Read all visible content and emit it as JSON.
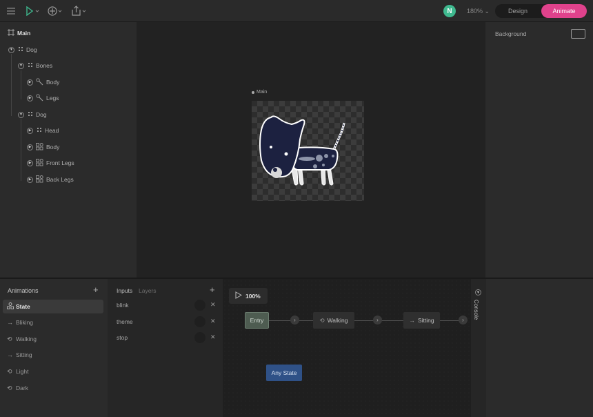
{
  "toolbar": {
    "menu_icon": "hamburger-icon",
    "select_tool_icon": "pointer-icon",
    "add_tool_icon": "plus-circle-icon",
    "export_tool_icon": "share-icon",
    "avatar_initial": "N",
    "zoom": "180%",
    "mode_design": "Design",
    "mode_animate": "Animate",
    "accent_color": "#e0428c"
  },
  "hierarchy": {
    "items": [
      {
        "label": "Main",
        "icon": "artboard-icon"
      },
      {
        "label": "Dog",
        "icon": "group-icon"
      },
      {
        "label": "Bones",
        "icon": "group-icon"
      },
      {
        "label": "Body",
        "icon": "bone-icon"
      },
      {
        "label": "Legs",
        "icon": "bone-icon"
      },
      {
        "label": "Dog",
        "icon": "group-icon"
      },
      {
        "label": "Head",
        "icon": "group-icon"
      },
      {
        "label": "Body",
        "icon": "shapes-icon"
      },
      {
        "label": "Front Legs",
        "icon": "shapes-icon"
      },
      {
        "label": "Back Legs",
        "icon": "shapes-icon"
      }
    ]
  },
  "canvas": {
    "artboard_label": "Main"
  },
  "inspector": {
    "background_label": "Background"
  },
  "animations": {
    "title": "Animations",
    "items": [
      {
        "label": "State",
        "icon": "state-machine-icon",
        "active": true
      },
      {
        "label": "Bliking",
        "icon": "one-shot-icon"
      },
      {
        "label": "Walking",
        "icon": "loop-icon"
      },
      {
        "label": "Sitting",
        "icon": "one-shot-icon"
      },
      {
        "label": "Light",
        "icon": "loop-icon"
      },
      {
        "label": "Dark",
        "icon": "loop-icon"
      }
    ]
  },
  "inputs": {
    "tab_inputs": "Inputs",
    "tab_layers": "Layers",
    "items": [
      {
        "name": "blink"
      },
      {
        "name": "theme"
      },
      {
        "name": "stop"
      }
    ]
  },
  "graph": {
    "playback": "100%",
    "nodes": {
      "entry": "Entry",
      "walking": "Walking",
      "sitting": "Sitting",
      "any_state": "Any State"
    }
  },
  "console": {
    "label": "Console"
  }
}
